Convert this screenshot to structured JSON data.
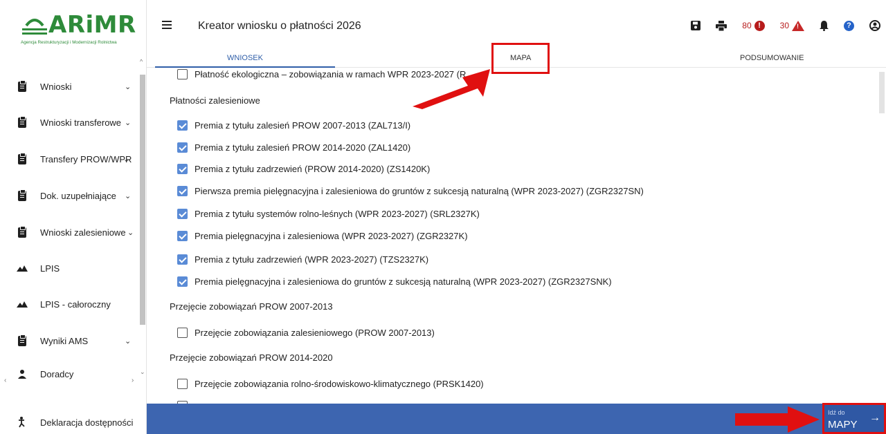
{
  "logo": {
    "name": "ARiMR",
    "subtitle": "Agencja Restrukturyzacji i Modernizacji Rolnictwa"
  },
  "sidebar": {
    "items": [
      {
        "label": "Wnioski",
        "icon": "clipboard-icon",
        "chevron": "⌄"
      },
      {
        "label": "Wnioski transferowe",
        "icon": "clipboard-icon",
        "chevron": "⌄"
      },
      {
        "label": "Transfery PROW/WPR",
        "icon": "clipboard-icon",
        "chevron": "⌄"
      },
      {
        "label": "Dok. uzupełniające",
        "icon": "clipboard-icon",
        "chevron": "⌄"
      },
      {
        "label": "Wnioski zalesieniowe",
        "icon": "clipboard-icon",
        "chevron": "⌄"
      },
      {
        "label": "LPIS",
        "icon": "mountain-icon",
        "chevron": ""
      },
      {
        "label": "LPIS - całoroczny",
        "icon": "mountain-icon",
        "chevron": ""
      },
      {
        "label": "Wyniki AMS",
        "icon": "clipboard-icon",
        "chevron": "⌄"
      },
      {
        "label": "Doradcy",
        "icon": "person-icon",
        "chevron": ""
      }
    ],
    "footer": {
      "label": "Deklaracja dostępności",
      "icon": "accessibility-icon"
    }
  },
  "header": {
    "title": "Kreator wniosku o płatności 2026",
    "errors_count": "80",
    "warnings_count": "30"
  },
  "tabs": [
    {
      "label": "WNIOSEK",
      "active": true
    },
    {
      "label": "MAPA",
      "active": false
    },
    {
      "label": "PODSUMOWANIE",
      "active": false
    }
  ],
  "content": {
    "top_partial": "Płatność ekologiczna – zobowiązania w ramach WPR 2023-2027 (R",
    "sections": [
      {
        "title": "Płatności zalesieniowe",
        "items": [
          {
            "label": "Premia z tytułu zalesień PROW 2007-2013 (ZAL713/I)",
            "checked": true
          },
          {
            "label": "Premia z tytułu zalesień PROW 2014-2020 (ZAL1420)",
            "checked": true
          },
          {
            "label": "Premia z tytułu zadrzewień (PROW 2014-2020) (ZS1420K)",
            "checked": true
          },
          {
            "label": "Pierwsza premia pielęgnacyjna i zalesieniowa do gruntów z sukcesją naturalną (WPR 2023-2027) (ZGR2327SN)",
            "checked": true
          },
          {
            "label": "Premia z tytułu systemów rolno-leśnych (WPR 2023-2027) (SRL2327K)",
            "checked": true
          },
          {
            "label": "Premia pielęgnacyjna i zalesieniowa (WPR 2023-2027) (ZGR2327K)",
            "checked": true
          },
          {
            "label": "Premia z tytułu zadrzewień (WPR 2023-2027) (TZS2327K)",
            "checked": true
          },
          {
            "label": "Premia pielęgnacyjna i zalesieniowa do gruntów z sukcesją naturalną (WPR 2023-2027) (ZGR2327SNK)",
            "checked": true
          }
        ]
      },
      {
        "title": "Przejęcie zobowiązań PROW 2007-2013",
        "items": [
          {
            "label": "Przejęcie zobowiązania zalesieniowego (PROW 2007-2013)",
            "checked": false
          }
        ]
      },
      {
        "title": "Przejęcie zobowiązań PROW 2014-2020",
        "items": [
          {
            "label": "Przejęcie zobowiązania rolno-środowiskowo-klimatycznego (PRSK1420)",
            "checked": false
          }
        ]
      }
    ]
  },
  "bottom": {
    "goto_small": "Idź do",
    "goto_big": "MAPY",
    "goto_arrow": "→"
  },
  "colors": {
    "brand_green": "#2e8b3a",
    "primary_blue": "#3d65b0",
    "annotation_red": "#e01010",
    "error_red": "#b71c1c"
  }
}
